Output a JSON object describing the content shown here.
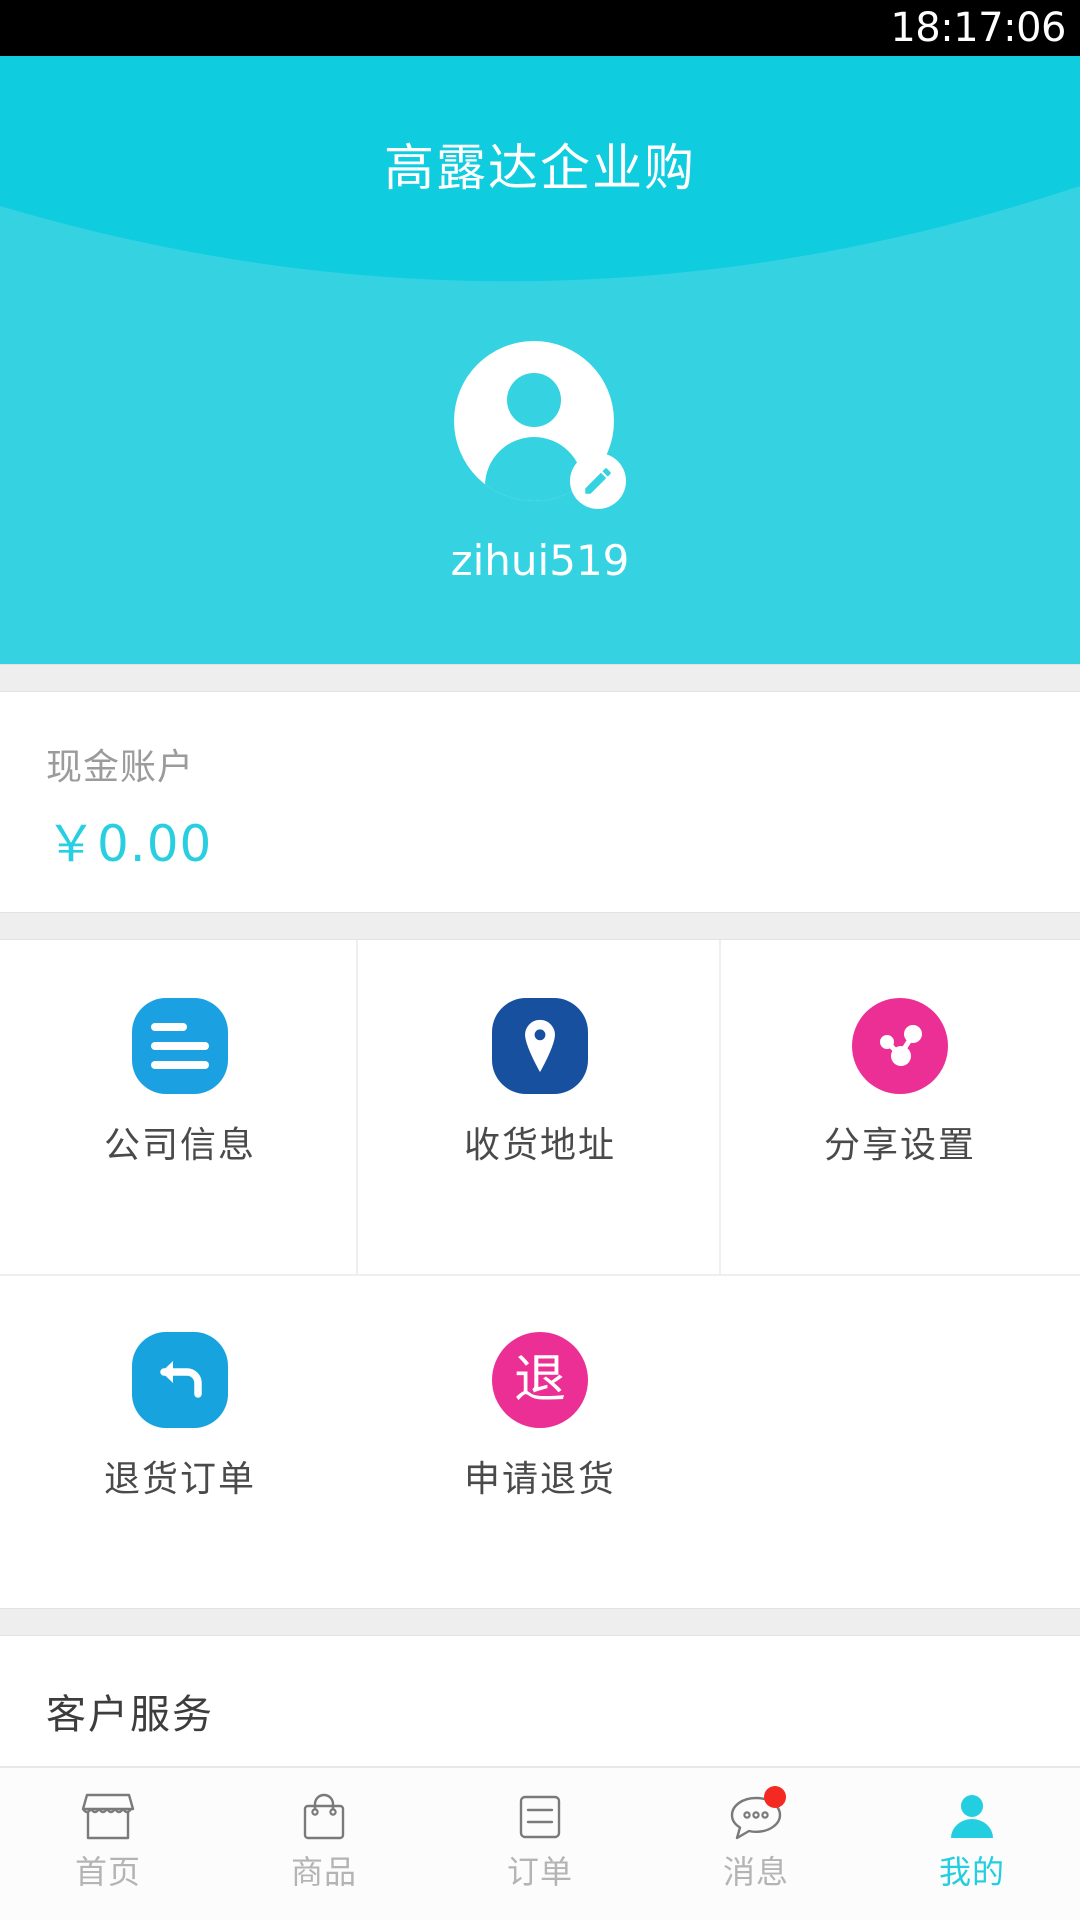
{
  "status_bar": {
    "time": "18:17:06"
  },
  "header": {
    "title": "高露达企业购",
    "username": "zihui519",
    "avatar_icon": "person-avatar-icon",
    "edit_icon": "pencil-edit-icon",
    "bg_color": "#35d2e2",
    "bg_color_dark": "#0fccdf"
  },
  "cash_account": {
    "label": "现金账户",
    "amount": "￥0.00",
    "amount_color": "#29cfe0",
    "label_color": "#9b9b9b"
  },
  "grid": {
    "items": [
      {
        "label": "公司信息",
        "icon": "document-lines-icon",
        "color": "#1ba0e2",
        "shape": "squircle"
      },
      {
        "label": "收货地址",
        "icon": "location-pin-icon",
        "color": "#17509e",
        "shape": "squircle"
      },
      {
        "label": "分享设置",
        "icon": "share-network-icon",
        "color": "#ec2f95",
        "shape": "circle"
      },
      {
        "label": "退货订单",
        "icon": "return-arrow-icon",
        "color": "#17a3de",
        "shape": "squircle"
      },
      {
        "label": "申请退货",
        "icon": "return-char-icon",
        "color": "#ec2f95",
        "shape": "circle",
        "glyph": "退"
      }
    ]
  },
  "customer_service": {
    "title": "客户服务"
  },
  "tabbar": {
    "active_color": "#22cee0",
    "inactive_color": "#b4b4b4",
    "badge_color": "#f42a22",
    "tabs": [
      {
        "label": "首页",
        "icon": "storefront-icon",
        "active": false,
        "badge": false
      },
      {
        "label": "商品",
        "icon": "shopping-bag-icon",
        "active": false,
        "badge": false
      },
      {
        "label": "订单",
        "icon": "order-list-icon",
        "active": false,
        "badge": false
      },
      {
        "label": "消息",
        "icon": "chat-bubble-icon",
        "active": false,
        "badge": true
      },
      {
        "label": "我的",
        "icon": "person-icon",
        "active": true,
        "badge": false
      }
    ]
  }
}
